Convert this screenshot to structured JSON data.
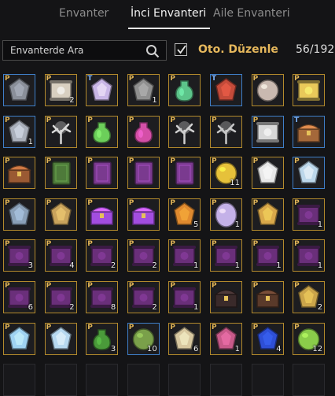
{
  "tabs": [
    {
      "label": "Envanter"
    },
    {
      "label": "İnci Envanteri"
    },
    {
      "label": "Aile Envanteri"
    }
  ],
  "search": {
    "placeholder": "Envanterde Ara"
  },
  "auto_arrange": {
    "label": "Oto. Düzenle",
    "checked": true
  },
  "capacity": {
    "text": "56/192"
  },
  "colors": {
    "accent": "#e6b85c",
    "slot_border": "#b38a2c",
    "rare_border": "#3f7fc9"
  },
  "slots": [
    {
      "badge": "P",
      "qty": "",
      "icon": "armor-icon",
      "c": "#8a8f99",
      "rare": true
    },
    {
      "badge": "P",
      "qty": "2",
      "icon": "scroll-icon",
      "c": "#d8cfc0"
    },
    {
      "badge": "T",
      "qty": "",
      "icon": "crystal-cushion-icon",
      "c": "#c9b6e6"
    },
    {
      "badge": "P",
      "qty": "1",
      "icon": "anvil-icon",
      "c": "#8f8f8f"
    },
    {
      "badge": "P",
      "qty": "",
      "icon": "potion-set-icon",
      "c": "#5cc48a"
    },
    {
      "badge": "T",
      "qty": "",
      "icon": "mask-icon",
      "c": "#c44b3a",
      "rare": true
    },
    {
      "badge": "P",
      "qty": "",
      "icon": "orb-icon",
      "c": "#c9b9b0"
    },
    {
      "badge": "P",
      "qty": "",
      "icon": "golden-scroll-icon",
      "c": "#e9c95a"
    },
    {
      "badge": "P",
      "qty": "1",
      "icon": "horn-icon",
      "c": "#aab0bb",
      "rare": true
    },
    {
      "badge": "P",
      "qty": "",
      "icon": "white-tree-icon",
      "c": "#d9d9d9"
    },
    {
      "badge": "P",
      "qty": "",
      "icon": "potion-set-icon",
      "c": "#6ccf5a"
    },
    {
      "badge": "P",
      "qty": "",
      "icon": "potion-set-icon",
      "c": "#d44fa7"
    },
    {
      "badge": "P",
      "qty": "",
      "icon": "white-tree-icon",
      "c": "#d0d0d0"
    },
    {
      "badge": "P",
      "qty": "",
      "icon": "white-tree-icon",
      "c": "#c8c8c8"
    },
    {
      "badge": "P",
      "qty": "",
      "icon": "map-scroll-icon",
      "c": "#d8d8d8",
      "rare": true
    },
    {
      "badge": "T",
      "qty": "",
      "icon": "chest-icon",
      "c": "#a5683a",
      "rare": true
    },
    {
      "badge": "P",
      "qty": "",
      "icon": "chest-icon",
      "c": "#9a5a33"
    },
    {
      "badge": "P",
      "qty": "",
      "icon": "green-book-icon",
      "c": "#4e7a3a"
    },
    {
      "badge": "P",
      "qty": "",
      "icon": "purple-book-icon",
      "c": "#7a3a8f"
    },
    {
      "badge": "P",
      "qty": "",
      "icon": "purple-book-icon",
      "c": "#7a3a8f"
    },
    {
      "badge": "P",
      "qty": "",
      "icon": "purple-book-icon",
      "c": "#7a3a8f"
    },
    {
      "badge": "P",
      "qty": "11",
      "icon": "butterfly-coin-icon",
      "c": "#e6c13a"
    },
    {
      "badge": "P",
      "qty": "",
      "icon": "sheet-icon",
      "c": "#e8e8e8"
    },
    {
      "badge": "P",
      "qty": "",
      "icon": "paper-icon",
      "c": "#bcd7ea",
      "rare": true
    },
    {
      "badge": "P",
      "qty": "",
      "icon": "carpet-icon",
      "c": "#8aa0b8"
    },
    {
      "badge": "P",
      "qty": "",
      "icon": "chandelier-icon",
      "c": "#c9a35c"
    },
    {
      "badge": "P",
      "qty": "",
      "icon": "purple-chest-icon",
      "c": "#a24de0"
    },
    {
      "badge": "P",
      "qty": "",
      "icon": "purple-chest-icon",
      "c": "#a24de0"
    },
    {
      "badge": "P",
      "qty": "5",
      "icon": "pendant-icon",
      "c": "#e08a2f"
    },
    {
      "badge": "P",
      "qty": "1",
      "icon": "egg-icon",
      "c": "#c4b1e8"
    },
    {
      "badge": "P",
      "qty": "",
      "icon": "feather-icon",
      "c": "#d9a84a"
    },
    {
      "badge": "P",
      "qty": "1",
      "icon": "dark-scroll-icon",
      "c": "#6a2f7a"
    },
    {
      "badge": "P",
      "qty": "3",
      "icon": "dark-scroll-icon",
      "c": "#6a2f7a"
    },
    {
      "badge": "P",
      "qty": "4",
      "icon": "dark-scroll-icon",
      "c": "#6a2f7a"
    },
    {
      "badge": "P",
      "qty": "2",
      "icon": "dark-scroll-icon",
      "c": "#6a2f7a"
    },
    {
      "badge": "P",
      "qty": "2",
      "icon": "dark-scroll-icon",
      "c": "#6a2f7a"
    },
    {
      "badge": "P",
      "qty": "1",
      "icon": "dark-scroll-icon",
      "c": "#6a2f7a"
    },
    {
      "badge": "P",
      "qty": "1",
      "icon": "dark-scroll-icon",
      "c": "#6a2f7a"
    },
    {
      "badge": "P",
      "qty": "1",
      "icon": "dark-scroll-icon",
      "c": "#6a2f7a"
    },
    {
      "badge": "P",
      "qty": "1",
      "icon": "dark-scroll-icon",
      "c": "#6a2f7a"
    },
    {
      "badge": "P",
      "qty": "6",
      "icon": "dark-scroll-icon",
      "c": "#6a2f7a"
    },
    {
      "badge": "P",
      "qty": "2",
      "icon": "dark-scroll-icon",
      "c": "#6a2f7a"
    },
    {
      "badge": "P",
      "qty": "8",
      "icon": "dark-scroll-icon",
      "c": "#6a2f7a"
    },
    {
      "badge": "P",
      "qty": "2",
      "icon": "dark-scroll-icon",
      "c": "#6a2f7a"
    },
    {
      "badge": "P",
      "qty": "1",
      "icon": "dark-scroll-icon",
      "c": "#6a2f7a"
    },
    {
      "badge": "P",
      "qty": "",
      "icon": "black-chest-icon",
      "c": "#3a2a2a"
    },
    {
      "badge": "P",
      "qty": "",
      "icon": "open-chest-icon",
      "c": "#5a3a2a"
    },
    {
      "badge": "P",
      "qty": "2",
      "icon": "pouch-icon",
      "c": "#caa44a"
    },
    {
      "badge": "P",
      "qty": "",
      "icon": "ice-crystal-icon",
      "c": "#9fd3f2"
    },
    {
      "badge": "P",
      "qty": "",
      "icon": "crystal-lamp-icon",
      "c": "#b7d9f0"
    },
    {
      "badge": "P",
      "qty": "3",
      "icon": "green-vase-icon",
      "c": "#4a9a3a"
    },
    {
      "badge": "P",
      "qty": "10",
      "icon": "food-bowl-icon",
      "c": "#7aa04a",
      "rare": true
    },
    {
      "badge": "P",
      "qty": "6",
      "icon": "recipe-icon",
      "c": "#d8c8a0"
    },
    {
      "badge": "P",
      "qty": "1",
      "icon": "card-icon",
      "c": "#c85a8a"
    },
    {
      "badge": "P",
      "qty": "4",
      "icon": "blue-stone-icon",
      "c": "#2e4fd6"
    },
    {
      "badge": "P",
      "qty": "12",
      "icon": "herb-bowl-icon",
      "c": "#8acc4a"
    },
    {
      "badge": "",
      "qty": "",
      "icon": "",
      "c": "",
      "empty": true
    },
    {
      "badge": "",
      "qty": "",
      "icon": "",
      "c": "",
      "empty": true
    },
    {
      "badge": "",
      "qty": "",
      "icon": "",
      "c": "",
      "empty": true
    },
    {
      "badge": "",
      "qty": "",
      "icon": "",
      "c": "",
      "empty": true
    },
    {
      "badge": "",
      "qty": "",
      "icon": "",
      "c": "",
      "empty": true
    },
    {
      "badge": "",
      "qty": "",
      "icon": "",
      "c": "",
      "empty": true
    },
    {
      "badge": "",
      "qty": "",
      "icon": "",
      "c": "",
      "empty": true
    },
    {
      "badge": "",
      "qty": "",
      "icon": "",
      "c": "",
      "empty": true
    }
  ]
}
